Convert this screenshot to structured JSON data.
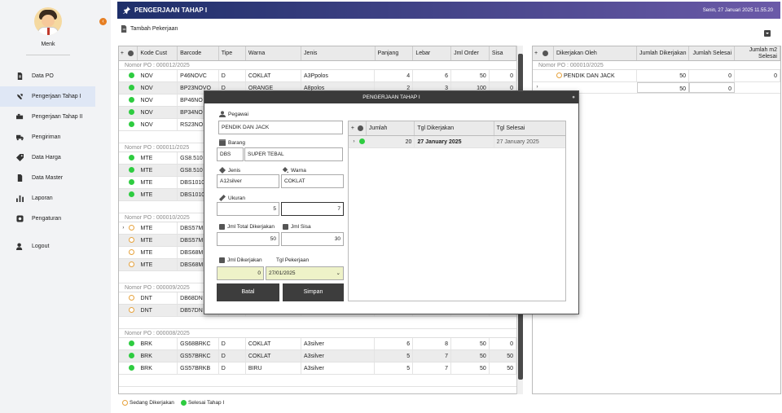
{
  "user": {
    "name": "Menk"
  },
  "nav": [
    {
      "label": "Data PO",
      "icon": "document-icon"
    },
    {
      "label": "Pengerjaan Tahap I",
      "icon": "tools-icon",
      "active": true
    },
    {
      "label": "Pengerjaan Tahap II",
      "icon": "tools-icon"
    },
    {
      "label": "Pengiriman",
      "icon": "truck-icon"
    },
    {
      "label": "Data Harga",
      "icon": "tag-icon"
    },
    {
      "label": "Data Master",
      "icon": "file-icon"
    },
    {
      "label": "Laporan",
      "icon": "bar-chart-icon"
    },
    {
      "label": "Pengaturan",
      "icon": "gear-icon"
    },
    {
      "label": "Logout",
      "icon": "logout-icon"
    }
  ],
  "header": {
    "title": "PENGERJAAN TAHAP I",
    "date": "Senin, 27 Januari 2025  11.55.20"
  },
  "toolbar": {
    "add_label": "Tambah Pekerjaan"
  },
  "main_grid": {
    "columns": [
      "Kode Cust",
      "Barcode",
      "Tipe",
      "Warna",
      "Jenis",
      "Panjang",
      "Lebar",
      "Jml Order",
      "Sisa"
    ],
    "groups": [
      {
        "label": "Nomor PO : 000012/2025",
        "rows": [
          {
            "status": "done",
            "cells": [
              "NOV",
              "P46NOVC",
              "D",
              "COKLAT",
              "A3Ppolos",
              "4",
              "6",
              "50",
              "0"
            ]
          },
          {
            "status": "done",
            "cells": [
              "NOV",
              "BP23NOVO",
              "D",
              "ORANGE",
              "A8polos",
              "2",
              "3",
              "100",
              "0"
            ]
          },
          {
            "status": "done",
            "cells": [
              "NOV",
              "BP46NO",
              "",
              "",
              "",
              "",
              "",
              "",
              ""
            ]
          },
          {
            "status": "done",
            "cells": [
              "NOV",
              "BP34NO",
              "",
              "",
              "",
              "",
              "",
              "",
              ""
            ]
          },
          {
            "status": "done",
            "cells": [
              "NOV",
              "RS23NO",
              "",
              "",
              "",
              "",
              "",
              "",
              ""
            ]
          }
        ]
      },
      {
        "label": "Nomor PO : 000011/2025",
        "rows": [
          {
            "status": "done",
            "cells": [
              "MTE",
              "GS8.510",
              "",
              "",
              "",
              "",
              "",
              "",
              ""
            ]
          },
          {
            "status": "done",
            "cells": [
              "MTE",
              "GS8.510",
              "",
              "",
              "",
              "",
              "",
              "",
              ""
            ]
          },
          {
            "status": "done",
            "cells": [
              "MTE",
              "DBS1010",
              "",
              "",
              "",
              "",
              "",
              "",
              ""
            ]
          },
          {
            "status": "done",
            "cells": [
              "MTE",
              "DBS1010",
              "",
              "",
              "",
              "",
              "",
              "",
              ""
            ]
          }
        ]
      },
      {
        "label": "Nomor PO : 000010/2025",
        "rows": [
          {
            "status": "progress",
            "cells": [
              "MTE",
              "DBS57M",
              "",
              "",
              "",
              "",
              "",
              "",
              ""
            ]
          },
          {
            "status": "progress",
            "cells": [
              "MTE",
              "DBS57M",
              "",
              "",
              "",
              "",
              "",
              "",
              ""
            ]
          },
          {
            "status": "progress",
            "cells": [
              "MTE",
              "DBS68M",
              "",
              "",
              "",
              "",
              "",
              "",
              ""
            ]
          },
          {
            "status": "progress",
            "cells": [
              "MTE",
              "DBS68M",
              "",
              "",
              "",
              "",
              "",
              "",
              ""
            ]
          }
        ]
      },
      {
        "label": "Nomor PO : 000009/2025",
        "rows": [
          {
            "status": "progress",
            "cells": [
              "DNT",
              "DB68DN",
              "",
              "",
              "",
              "",
              "",
              "",
              ""
            ]
          },
          {
            "status": "progress",
            "cells": [
              "DNT",
              "DB57DN",
              "",
              "",
              "",
              "",
              "",
              "",
              ""
            ]
          }
        ]
      },
      {
        "label": "Nomor PO : 000008/2025",
        "rows": [
          {
            "status": "done",
            "cells": [
              "BRK",
              "GS68BRKC",
              "D",
              "COKLAT",
              "A3silver",
              "6",
              "8",
              "50",
              "0"
            ]
          },
          {
            "status": "done",
            "cells": [
              "BRK",
              "GS57BRKC",
              "D",
              "COKLAT",
              "A3silver",
              "5",
              "7",
              "50",
              "50"
            ]
          },
          {
            "status": "done",
            "cells": [
              "BRK",
              "GS57BRKB",
              "D",
              "BIRU",
              "A3silver",
              "5",
              "7",
              "50",
              "50"
            ]
          }
        ]
      }
    ]
  },
  "side_grid": {
    "columns": [
      "Dikerjakan Oleh",
      "Jumlah Dikerjakan",
      "Jumlah Selesai",
      "Jumlah m2 Selesai"
    ],
    "group_label": "Nomor PO : 000010/2025",
    "row": {
      "cells": [
        "PENDIK DAN JACK",
        "50",
        "0",
        "0"
      ]
    },
    "totals": [
      "50",
      "0"
    ]
  },
  "legend": {
    "progress": "Sedang Dikerjakan",
    "done": "Selesai Tahap I"
  },
  "modal": {
    "title": "PENGERJAAN TAHAP I",
    "pegawai_label": "Pegawai",
    "pegawai_value": "PENDIK DAN JACK",
    "barang_label": "Barang",
    "barang_code": "DBS",
    "barang_name": "SUPER TEBAL",
    "jenis_label": "Jenis",
    "jenis_value": "A12silver",
    "warna_label": "Warna",
    "warna_value": "COKLAT",
    "ukuran_label": "Ukuran",
    "ukuran_p": "5",
    "ukuran_l": "7",
    "total_label": "Jml Total Dikerjakan",
    "total_value": "50",
    "sisa_label": "Jml Sisa",
    "sisa_value": "30",
    "dikerjakan_label": "Jml Dikerjakan",
    "dikerjakan_value": "0",
    "tgl_label": "Tgl Pekerjaan",
    "tgl_value": "27/01/2025",
    "batal": "Batal",
    "simpan": "Simpan",
    "grid": {
      "columns": [
        "Jumlah",
        "Tgl Dikerjakan",
        "Tgl Selesai"
      ],
      "row": [
        "20",
        "27 January 2025",
        "27 January 2025"
      ]
    }
  }
}
